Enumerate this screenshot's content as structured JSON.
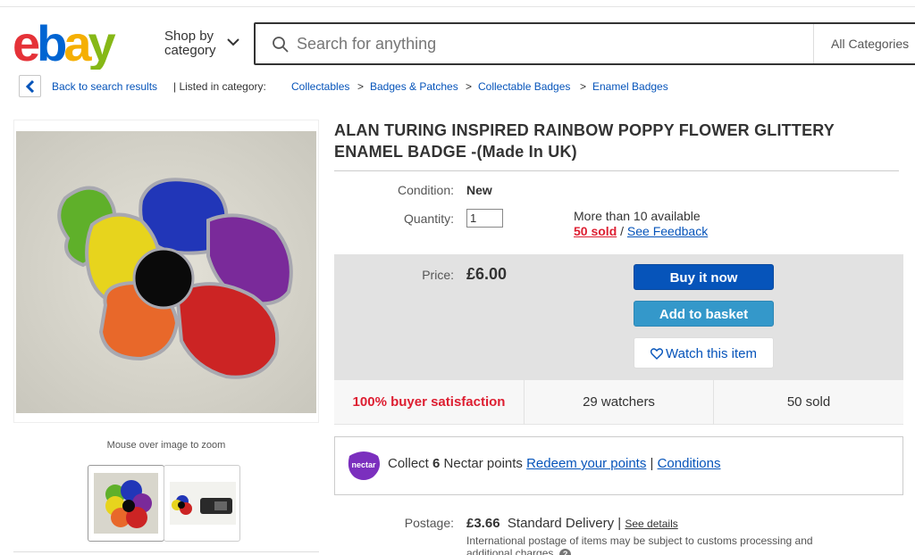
{
  "header": {
    "logo_text": "ebay",
    "shop_by_line1": "Shop by",
    "shop_by_line2": "category",
    "search_placeholder": "Search for anything",
    "category_select": "All Categories"
  },
  "breadcrumb": {
    "back_label": "Back to search results",
    "listed_in": "| Listed in category:",
    "items": [
      "Collectables",
      "Badges & Patches",
      "Collectable Badges",
      "Enamel Badges"
    ],
    "separator": ">"
  },
  "gallery": {
    "zoom_note": "Mouse over image to zoom"
  },
  "item": {
    "title": "ALAN TURING INSPIRED RAINBOW POPPY FLOWER GLITTERY ENAMEL BADGE -(Made In UK)",
    "condition_label": "Condition:",
    "condition_value": "New",
    "quantity_label": "Quantity:",
    "quantity_value": "1",
    "availability": "More than 10 available",
    "sold_link": "50 sold",
    "slash": "/",
    "feedback_link": "See Feedback"
  },
  "purchase": {
    "price_label": "Price:",
    "price_value": "£6.00",
    "buy_now": "Buy it now",
    "add_to_basket": "Add to basket",
    "watch": "Watch this item"
  },
  "stats": {
    "satisfaction": "100% buyer satisfaction",
    "watchers": "29 watchers",
    "sold": "50 sold"
  },
  "nectar": {
    "logo_text": "nectar",
    "collect_pre": "Collect",
    "points": "6",
    "collect_post": "Nectar points",
    "redeem_link": "Redeem your points",
    "divider": "|",
    "conditions_link": "Conditions"
  },
  "postage": {
    "label": "Postage:",
    "price": "£3.66",
    "method": "Standard Delivery |",
    "see_details": "See details",
    "note": "International postage of items may be subject to customs processing and additional charges."
  },
  "colors": {
    "brand_blue": "#0654ba",
    "basket_blue": "#3498ca",
    "alert_red": "#dd1e31",
    "nectar_purple": "#7b2fbe"
  }
}
